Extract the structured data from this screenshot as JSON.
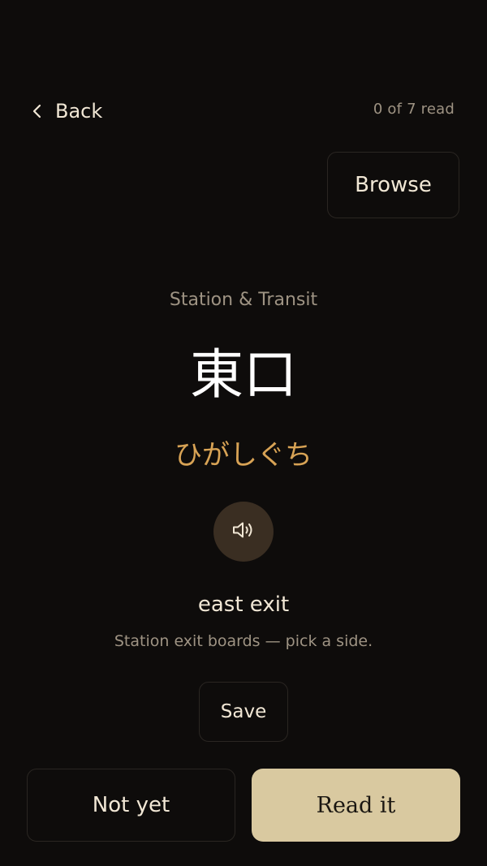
{
  "header": {
    "back_label": "Back",
    "progress": "0 of 7 read",
    "browse_label": "Browse"
  },
  "card": {
    "category": "Station & Transit",
    "kanji": "東口",
    "reading": "ひがしぐち",
    "audio_icon": "speaker-icon",
    "meaning": "east exit",
    "note": "Station exit boards — pick a side."
  },
  "actions": {
    "save_label": "Save",
    "not_yet_label": "Not yet",
    "read_it_label": "Read it"
  },
  "colors": {
    "background": "#0e0c0b",
    "accent_reading": "#d8a355",
    "primary_button": "#d9c9a0",
    "audio_button": "#3a2e22",
    "muted_text": "#9e9383"
  }
}
